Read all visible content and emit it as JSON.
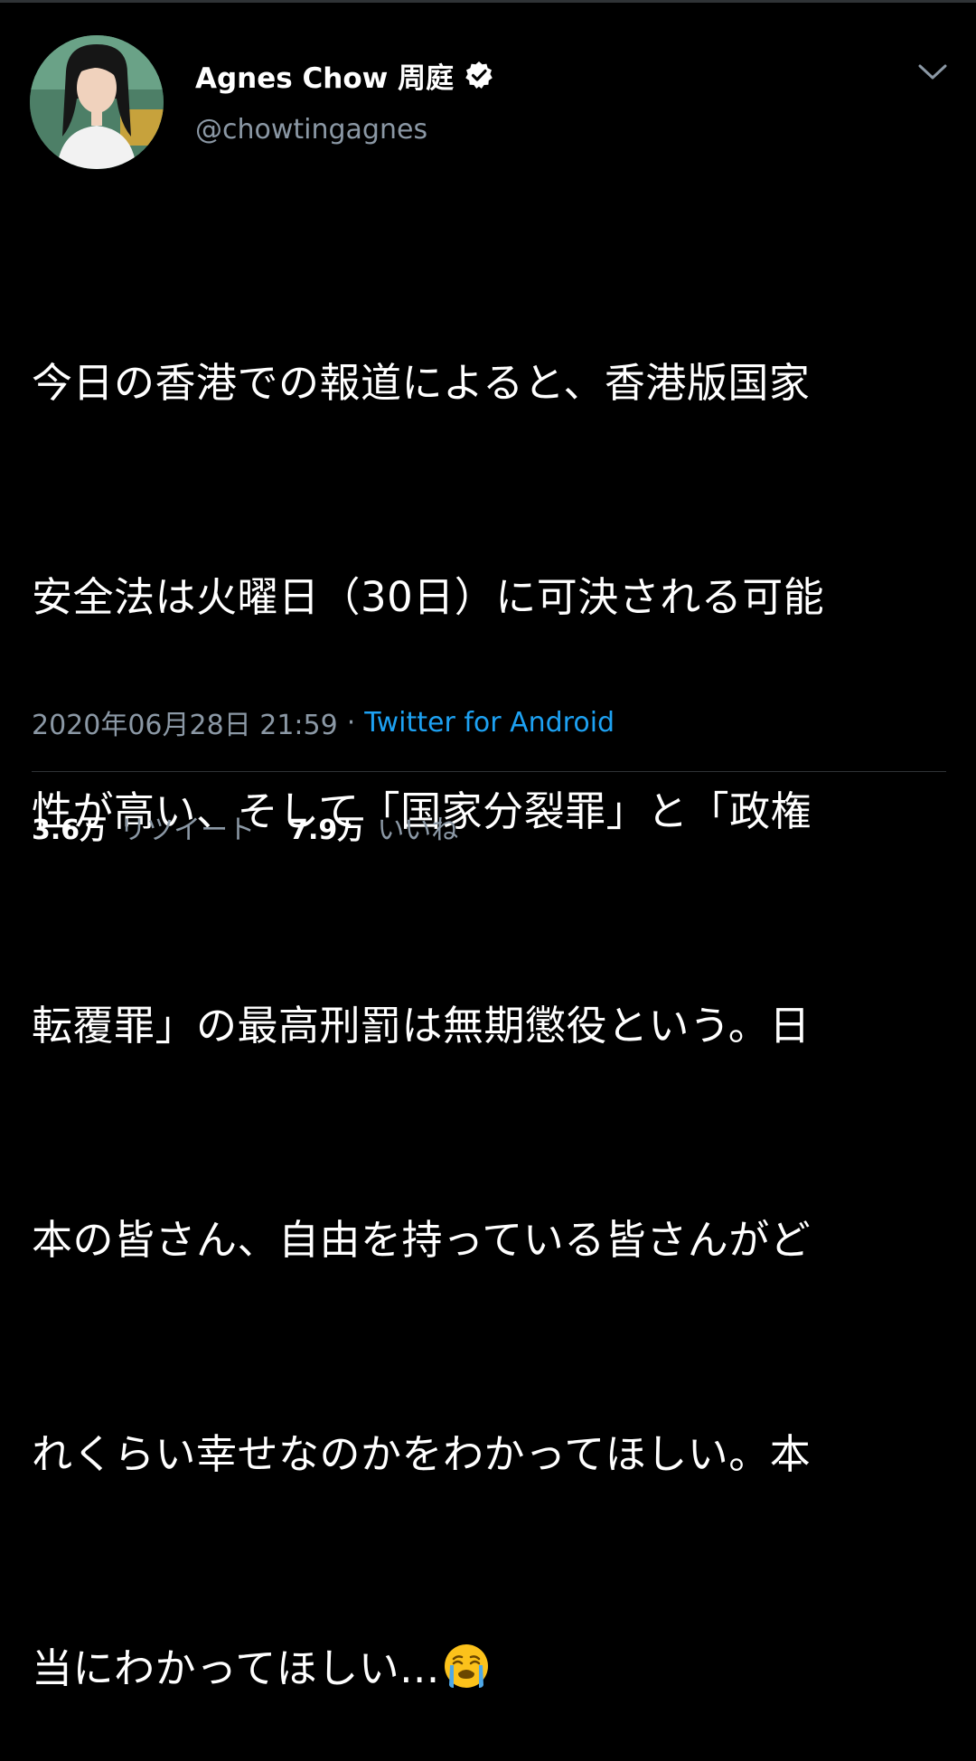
{
  "author": {
    "display_name": "Agnes Chow 周庭",
    "handle": "@chowtingagnes",
    "verified": true
  },
  "tweet": {
    "lines": [
      "今日の香港での報道によると、香港版国家",
      "安全法は火曜日（30日）に可決される可能",
      "性が高い、そして「国家分裂罪」と「政権",
      "転覆罪」の最高刑罰は無期懲役という。日",
      "本の皆さん、自由を持っている皆さんがど",
      "れくらい幸せなのかをわかってほしい。本",
      "当にわかってほしい..."
    ],
    "trailing_emoji": "loudly-crying-face-emoji"
  },
  "meta": {
    "timestamp": "2020年06月28日 21:59",
    "separator": "·",
    "source": "Twitter for Android"
  },
  "stats": {
    "retweets_count": "3.6万",
    "retweets_label": "リツイート",
    "likes_count": "7.9万",
    "likes_label": "いいね"
  },
  "colors": {
    "background": "#000000",
    "text_primary": "#ffffff",
    "text_secondary": "#8b98a5",
    "link": "#1da1f2",
    "divider": "#2f3336"
  },
  "icons": {
    "verified": "verified-badge-icon",
    "more": "chevron-down-icon"
  }
}
